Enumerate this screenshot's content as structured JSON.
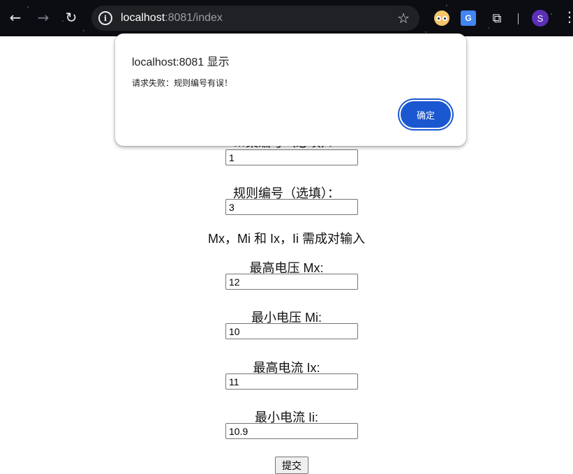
{
  "browser": {
    "back_icon": "←",
    "forward_icon": "→",
    "reload_icon": "↻",
    "site_info_icon": "i",
    "url_host": "localhost",
    "url_rest": ":8081/index",
    "star_icon": "☆",
    "avatar_letter": "S",
    "translate_icon_text": "G",
    "puzzle_icon": "⧉",
    "menu_icon": "⋮"
  },
  "form": {
    "partial_label": "…案编号（必填）：",
    "scheme_value": "1",
    "rule_label": "规则编号（选填）：",
    "rule_value": "3",
    "note": "Mx，Mi 和 Ix，Ii 需成对输入",
    "max_voltage_label": "最高电压 Mx:",
    "max_voltage_value": "12",
    "min_voltage_label": "最小电压 Mi:",
    "min_voltage_value": "10",
    "max_current_label": "最高电流 Ix:",
    "max_current_value": "11",
    "min_current_label": "最小电流 Ii:",
    "min_current_value": "10.9",
    "submit_label": "提交"
  },
  "dialog": {
    "title": "localhost:8081 显示",
    "message": "请求失败：规则编号有误！",
    "ok_label": "确定"
  },
  "colors": {
    "accent": "#1a57d0",
    "chrome_bg": "#0b0d12",
    "omnibox_bg": "#202124",
    "avatar_bg": "#5b2fb6"
  }
}
